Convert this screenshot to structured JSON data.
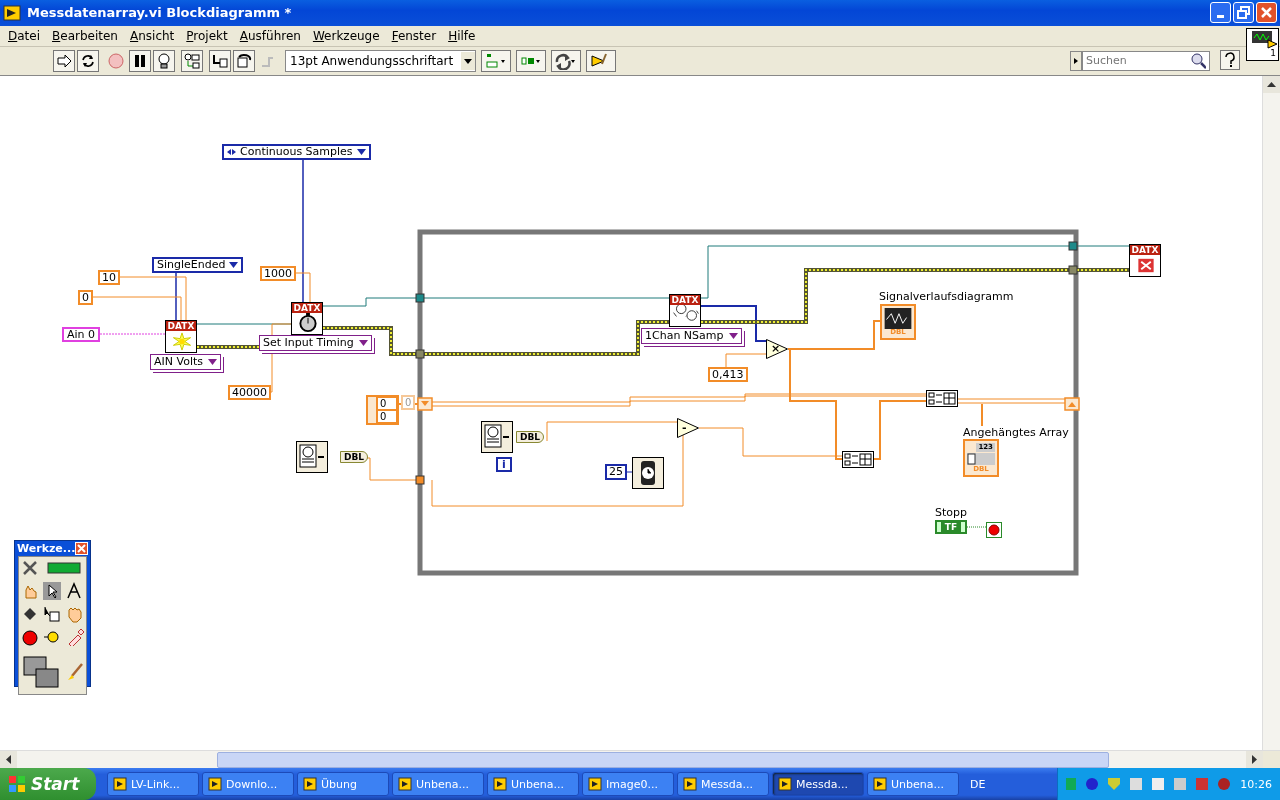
{
  "window": {
    "title": "Messdatenarray.vi Blockdiagramm *"
  },
  "menu": [
    "Datei",
    "Bearbeiten",
    "Ansicht",
    "Projekt",
    "Ausführen",
    "Werkzeuge",
    "Fenster",
    "Hilfe"
  ],
  "toolbar": {
    "buttons": [
      {
        "disabled": false
      },
      {
        "disabled": false
      },
      {
        "disabled": true
      },
      {
        "disabled": false
      },
      {
        "disabled": false
      },
      {
        "disabled": false
      },
      {
        "disabled": false
      },
      {
        "disabled": false
      },
      {
        "disabled": true
      }
    ],
    "font": "13pt Anwendungsschriftart",
    "search": {
      "placeholder": "Suchen"
    },
    "vi_icon_label": "1"
  },
  "diagram": {
    "items": [
      {
        "kind": "enum",
        "text": "Continuous Samples"
      },
      {
        "kind": "enum",
        "text": "SingleEnded"
      },
      {
        "kind": "numeric",
        "text": "10"
      },
      {
        "kind": "numeric",
        "text": "0"
      },
      {
        "kind": "string",
        "text": "Ain 0"
      },
      {
        "kind": "daqmx",
        "text": "DATX"
      },
      {
        "kind": "ring",
        "text": "AIN Volts"
      },
      {
        "kind": "numeric",
        "text": "1000"
      },
      {
        "kind": "daqmx",
        "text": "DATX"
      },
      {
        "kind": "ring",
        "text": "Set Input Timing"
      },
      {
        "kind": "numeric",
        "text": "40000"
      },
      {
        "kind": "array",
        "values": [
          "0",
          "0"
        ],
        "index": "0"
      },
      {
        "kind": "tick",
        "text": "DBL"
      },
      {
        "kind": "daqmx",
        "text": "DATX"
      },
      {
        "kind": "ring",
        "text": "1Chan NSamp"
      },
      {
        "kind": "operator",
        "text": "×"
      },
      {
        "kind": "numeric",
        "text": "0,413"
      },
      {
        "kind": "label",
        "text": "Signalverlaufsdiagramm"
      },
      {
        "kind": "chart_terminal",
        "text": "DBL"
      },
      {
        "kind": "build_array"
      },
      {
        "kind": "tick",
        "text": "DBL"
      },
      {
        "kind": "iteration",
        "text": "i"
      },
      {
        "kind": "operator",
        "text": "-"
      },
      {
        "kind": "int",
        "text": "25"
      },
      {
        "kind": "wait"
      },
      {
        "kind": "build_array"
      },
      {
        "kind": "label",
        "text": "Angehängtes Array"
      },
      {
        "kind": "array_terminal",
        "text": "DBL",
        "digits": "123"
      },
      {
        "kind": "label",
        "text": "Stopp"
      },
      {
        "kind": "boolean",
        "text": "TF"
      },
      {
        "kind": "stop"
      },
      {
        "kind": "daqmx",
        "text": "DATX"
      }
    ]
  },
  "palette": {
    "title": "Werkze..."
  },
  "taskbar": {
    "start": "Start",
    "items": [
      {
        "text": "LV-Link...",
        "selected": false
      },
      {
        "text": "Downlo...",
        "selected": false
      },
      {
        "text": "Übung",
        "selected": false
      },
      {
        "text": "Unbena...",
        "selected": false
      },
      {
        "text": "Unbena...",
        "selected": false
      },
      {
        "text": "Image0...",
        "selected": false
      },
      {
        "text": "Messda...",
        "selected": false
      },
      {
        "text": "Messda...",
        "selected": true
      },
      {
        "text": "Unbena...",
        "selected": false
      }
    ],
    "language": "DE",
    "clock": "10:26"
  }
}
